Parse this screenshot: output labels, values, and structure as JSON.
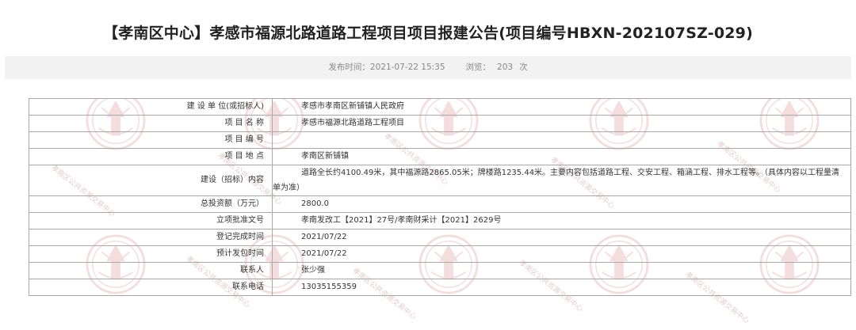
{
  "title": "【孝南区中心】孝感市福源北路道路工程项目项目报建公告(项目编号HBXN-202107SZ-029)",
  "meta": {
    "publish_label": "发布时间：",
    "publish_time": "2021-07-22 15:35",
    "views_label": "浏览：",
    "views_count": "203",
    "views_unit": "次"
  },
  "watermark": {
    "text": "孝南区公共资源交易中心"
  },
  "table": {
    "rows": [
      {
        "label": "建 设 单 位(或招标人)",
        "value": "孝感市孝南区新铺镇人民政府"
      },
      {
        "label": "项 目 名 称",
        "value": "孝感市福源北路道路工程项目"
      },
      {
        "label": "项 目 编 号",
        "value": ""
      },
      {
        "label": "项 目 地 点",
        "value": "孝南区新铺镇"
      },
      {
        "label": "建设（招标）内容",
        "value_line1": "道路全长约4100.49米，其中福源路2865.05米；牌楼路1235.44米。主要内容包括道路工程、交安工程、箱涵工程、排水工程等。（具体内容以工程量清",
        "value_line2": "单为准）"
      },
      {
        "label": "总投资额（万元）",
        "value": "2800.0"
      },
      {
        "label": "立项批准文号",
        "value": "孝南发改工【2021】27号/孝南财采计【2021】2629号"
      },
      {
        "label": "登记完成时间",
        "value": "2021/07/22"
      },
      {
        "label": "预计发包时间",
        "value": "2021/07/22"
      },
      {
        "label": "联系人",
        "value": "张少强"
      },
      {
        "label": "联系电话",
        "value": "13035155359"
      }
    ]
  }
}
